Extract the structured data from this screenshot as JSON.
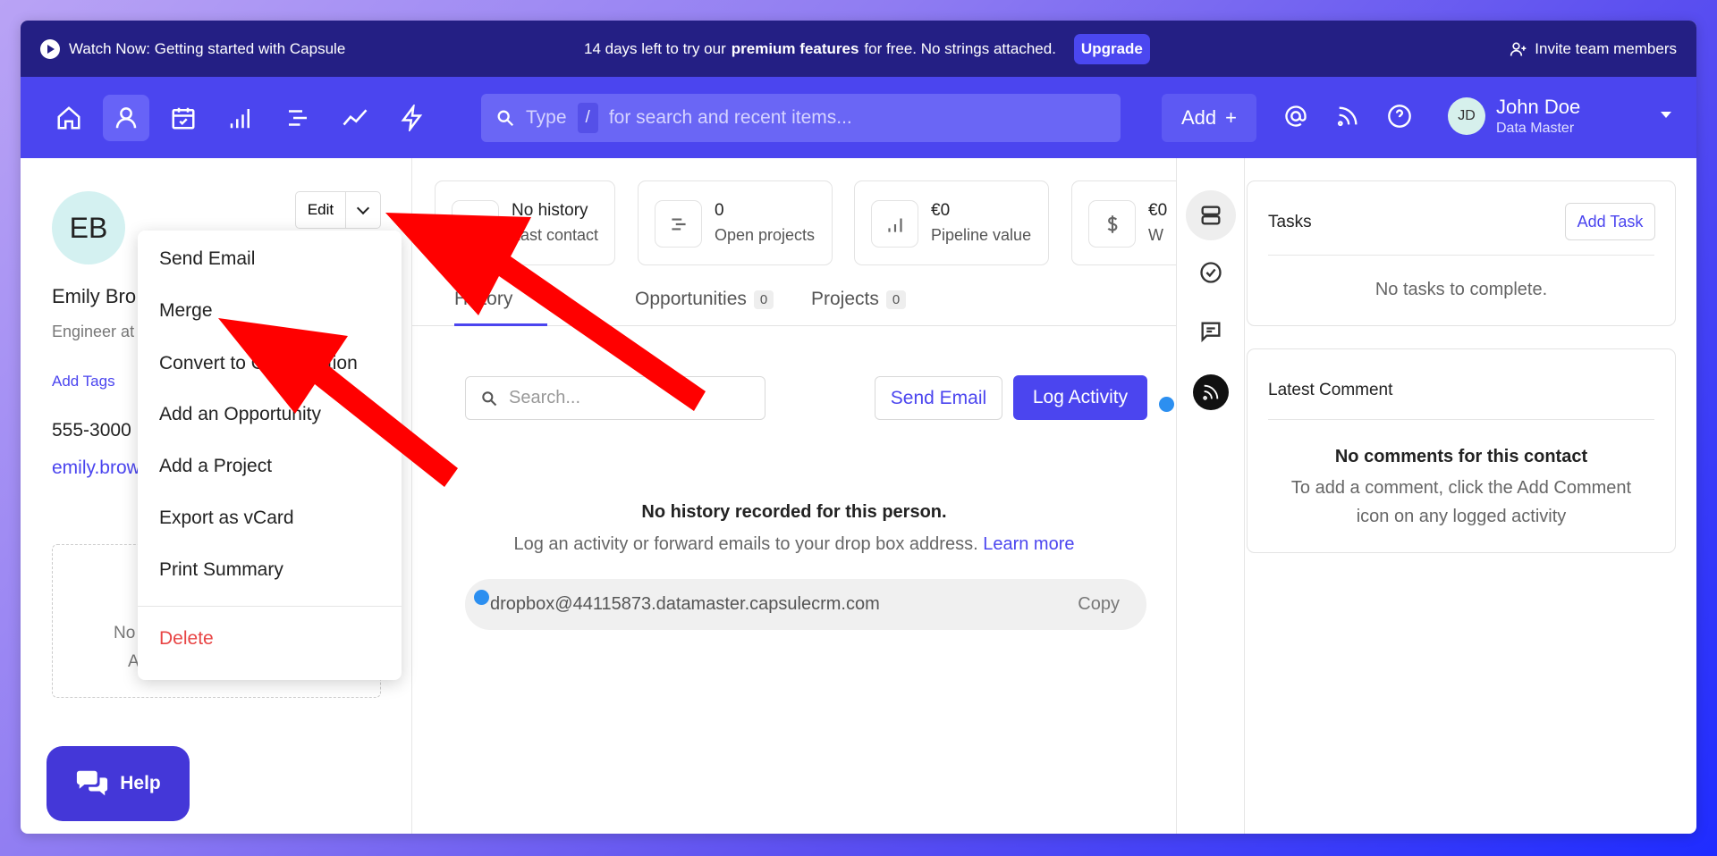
{
  "promo": {
    "watch": "Watch Now: Getting started with Capsule",
    "trial_prefix": "14 days left to try our",
    "trial_bold": "premium features",
    "trial_suffix": "for free. No strings attached.",
    "upgrade": "Upgrade",
    "invite": "Invite team members"
  },
  "nav": {
    "search_type": "Type",
    "search_slash": "/",
    "search_rest": "for search and recent items...",
    "add": "Add",
    "user_initials": "JD",
    "user_name": "John Doe",
    "user_role": "Data Master"
  },
  "contact": {
    "initials": "EB",
    "name": "Emily Bro",
    "title": "Engineer at",
    "add_tags": "Add Tags",
    "phone": "555-3000",
    "email": "emily.brow",
    "edit": "Edit",
    "box_line1": "No",
    "box_line2": "A"
  },
  "menu": {
    "items": [
      "Send Email",
      "Merge",
      "Convert to Organisation",
      "Add an Opportunity",
      "Add a Project",
      "Export as vCard",
      "Print Summary"
    ],
    "delete": "Delete"
  },
  "stats": [
    {
      "value": "No history",
      "label": "Last contact",
      "icon": "calendar-icon"
    },
    {
      "value": "0",
      "label": "Open projects",
      "icon": "list-icon"
    },
    {
      "value": "€0",
      "label": "Pipeline value",
      "icon": "bar-chart-icon"
    },
    {
      "value": "€0",
      "label": "W",
      "icon": "dollar-icon"
    }
  ],
  "tabs": [
    {
      "label": "History",
      "count": ""
    },
    {
      "label": "Opportunities",
      "count": "0"
    },
    {
      "label": "Projects",
      "count": "0"
    }
  ],
  "history": {
    "search_placeholder": "Search...",
    "send_email": "Send Email",
    "log_activity": "Log Activity",
    "empty_title": "No history recorded for this person.",
    "empty_text": "Log an activity or forward emails to your drop box address.",
    "learn_more": "Learn more",
    "dropbox": "dropbox@44115873.datamaster.capsulecrm.com",
    "copy": "Copy"
  },
  "tasks": {
    "title": "Tasks",
    "add": "Add Task",
    "empty": "No tasks to complete."
  },
  "comments": {
    "title": "Latest Comment",
    "empty_title": "No comments for this contact",
    "empty_line1": "To add a comment, click the Add Comment",
    "empty_line2": "icon on any logged activity"
  },
  "help": {
    "label": "Help"
  },
  "colors": {
    "brand": "#4b45ef",
    "promo_bg": "#241f84",
    "delete": "#e84545",
    "annotation": "#ff0000"
  }
}
